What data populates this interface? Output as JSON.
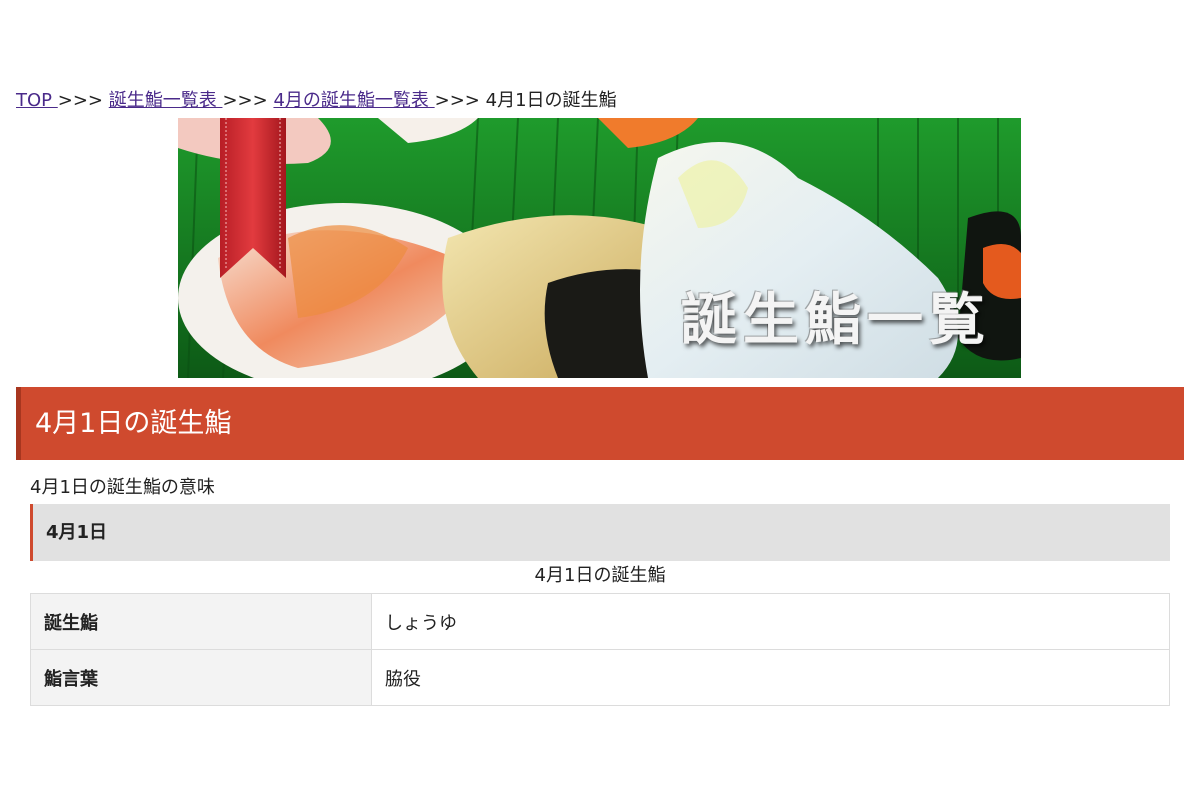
{
  "breadcrumb": {
    "items": [
      {
        "label": "TOP ",
        "link": true
      },
      {
        "label": "誕生鮨一覧表 ",
        "link": true
      },
      {
        "label": "4月の誕生鮨一覧表 ",
        "link": true
      },
      {
        "label": "4月1日の誕生鮨",
        "link": false
      }
    ],
    "separator": ">>>"
  },
  "banner": {
    "title": "誕生鮨一覧"
  },
  "heading": "4月1日の誕生鮨",
  "meaning_line": "4月1日の誕生鮨の意味",
  "date_box": "4月1日",
  "table": {
    "caption": "4月1日の誕生鮨",
    "rows": [
      {
        "label": "誕生鮨",
        "value": "しょうゆ"
      },
      {
        "label": "鮨言葉",
        "value": "脇役"
      }
    ]
  },
  "colors": {
    "accent": "#cf4a2e",
    "link": "#4a2a8a",
    "date_box_bg": "#e1e1e1"
  }
}
